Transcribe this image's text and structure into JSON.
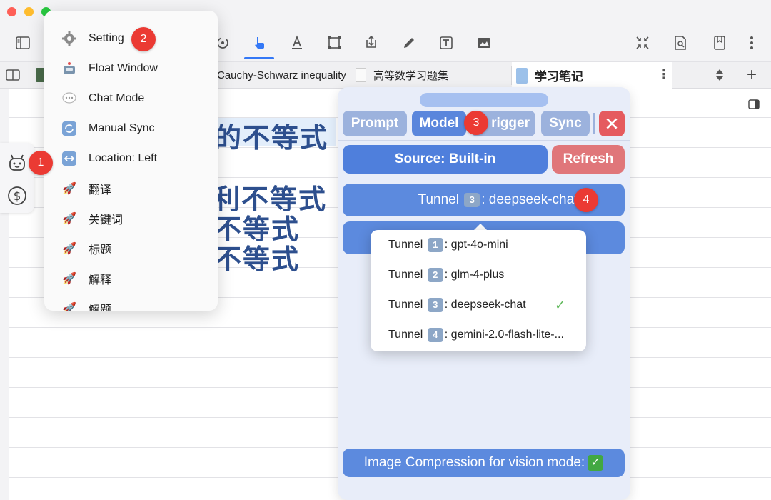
{
  "colors": {
    "accent": "#3478f6",
    "badge": "#eb3a33",
    "panel_blue": "#5c8ade",
    "close_red": "#e55a5f"
  },
  "tabs": [
    {
      "label": "Cauchy-Schwarz inequality"
    },
    {
      "label": "高等数学习题集"
    },
    {
      "label": "学习笔记"
    }
  ],
  "page": {
    "line1": "的不等式",
    "line2": "利不等式",
    "line3": "不等式",
    "line4": "不等式"
  },
  "badges": [
    "1",
    "2",
    "3",
    "4"
  ],
  "menu": {
    "items": [
      {
        "icon": "gear-icon",
        "label": "Setting"
      },
      {
        "icon": "robot-icon",
        "label": "Float Window"
      },
      {
        "icon": "speech-bubble-icon",
        "label": "Chat Mode"
      },
      {
        "icon": "sync-icon",
        "label": "Manual Sync"
      },
      {
        "icon": "left-right-arrow-icon",
        "label": "Location: Left"
      },
      {
        "icon": "rocket-icon",
        "label": "翻译"
      },
      {
        "icon": "rocket-icon",
        "label": "关键词"
      },
      {
        "icon": "rocket-icon",
        "label": "标题"
      },
      {
        "icon": "rocket-icon",
        "label": "解释"
      },
      {
        "icon": "rocket-icon",
        "label": "解题"
      }
    ]
  },
  "panel": {
    "tabs": [
      "Prompt",
      "Model",
      "rigger",
      "Sync"
    ],
    "active_tab": "Model",
    "source_label": "Source: Built-in",
    "refresh_label": "Refresh",
    "tunnel_selected": {
      "prefix": "Tunnel",
      "num": "3",
      "model": ": deepseek-chat"
    },
    "compression_label": "Image Compression for vision mode:",
    "compression_check": "✓"
  },
  "dropdown": {
    "options": [
      {
        "prefix": "Tunnel",
        "num": "1",
        "model": ": gpt-4o-mini",
        "selected": false
      },
      {
        "prefix": "Tunnel",
        "num": "2",
        "model": ": glm-4-plus",
        "selected": false
      },
      {
        "prefix": "Tunnel",
        "num": "3",
        "model": ": deepseek-chat",
        "selected": true
      },
      {
        "prefix": "Tunnel",
        "num": "4",
        "model": ": gemini-2.0-flash-lite-...",
        "selected": false
      }
    ],
    "check": "✓"
  }
}
